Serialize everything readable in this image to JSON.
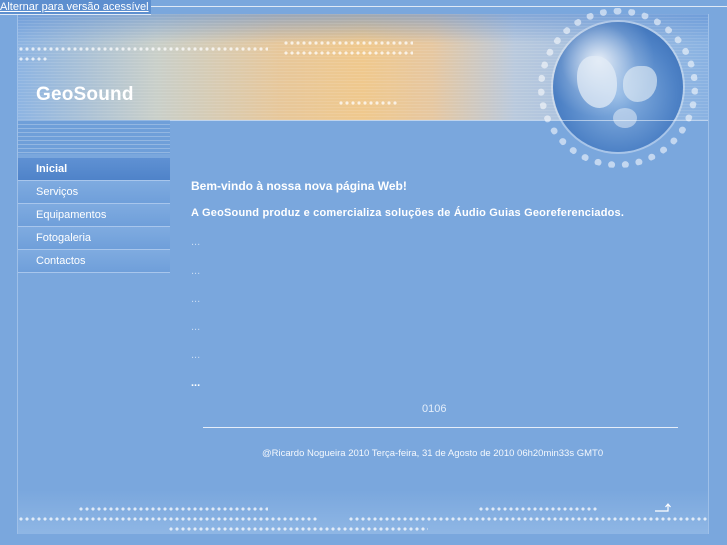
{
  "skip_link": {
    "label": "Alternar para versão acessível"
  },
  "header": {
    "brand": "GeoSound"
  },
  "nav": {
    "items": [
      {
        "label": "Inicial"
      },
      {
        "label": "Serviços"
      },
      {
        "label": "Equipamentos"
      },
      {
        "label": "Fotogaleria"
      },
      {
        "label": "Contactos"
      }
    ],
    "active": "Inicial"
  },
  "main": {
    "welcome": "Bem-vindo à nossa nova página Web!",
    "intro": "A GeoSound produz e comercializa soluções de Áudio Guias Georeferenciados.",
    "placeholders": [
      "...",
      "...",
      "...",
      "...",
      "...",
      "..."
    ],
    "counter": "0106"
  },
  "footer": {
    "text": "@Ricardo Nogueira 2010 Terça-feira, 31 de Agosto de 2010 06h20min33s GMT0",
    "top_icon": "return-arrow-icon"
  },
  "colors": {
    "background": "#7aa7dd",
    "nav_active": "#5688cc",
    "text": "#ffffff"
  }
}
